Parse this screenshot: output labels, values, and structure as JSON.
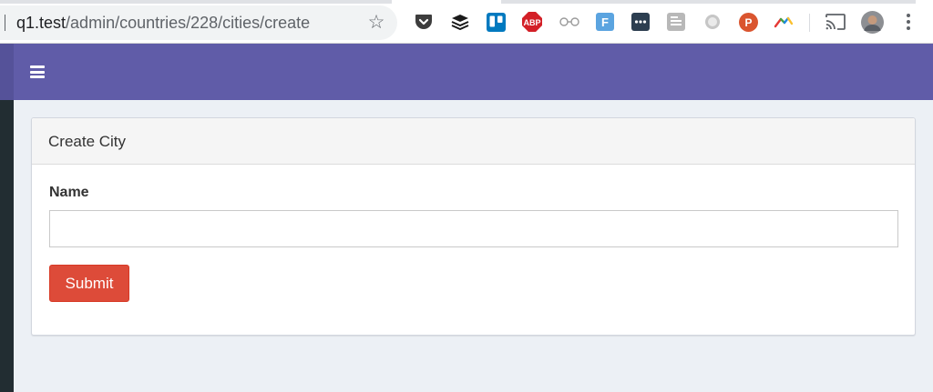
{
  "browser": {
    "url_host": "q1.test",
    "url_path": "/admin/countries/228/cities/create",
    "extensions": [
      "pocket-icon",
      "buffer-icon",
      "trello-icon",
      "adblock-plus-icon",
      "glasses-icon",
      "feedly-icon",
      "dots-extension-icon",
      "stack-icon",
      "grey-circle-icon",
      "producthunt-icon",
      "rainbow-arc-icon"
    ],
    "abp_label": "ABP",
    "feedly_label": "F",
    "producthunt_label": "P"
  },
  "page": {
    "card_title": "Create City",
    "name_label": "Name",
    "name_value": "",
    "name_placeholder": "",
    "submit_label": "Submit"
  },
  "colors": {
    "header": "#605ca8",
    "submit": "#dd4b39",
    "sidebar": "#222d32",
    "background": "#ecf0f5"
  }
}
